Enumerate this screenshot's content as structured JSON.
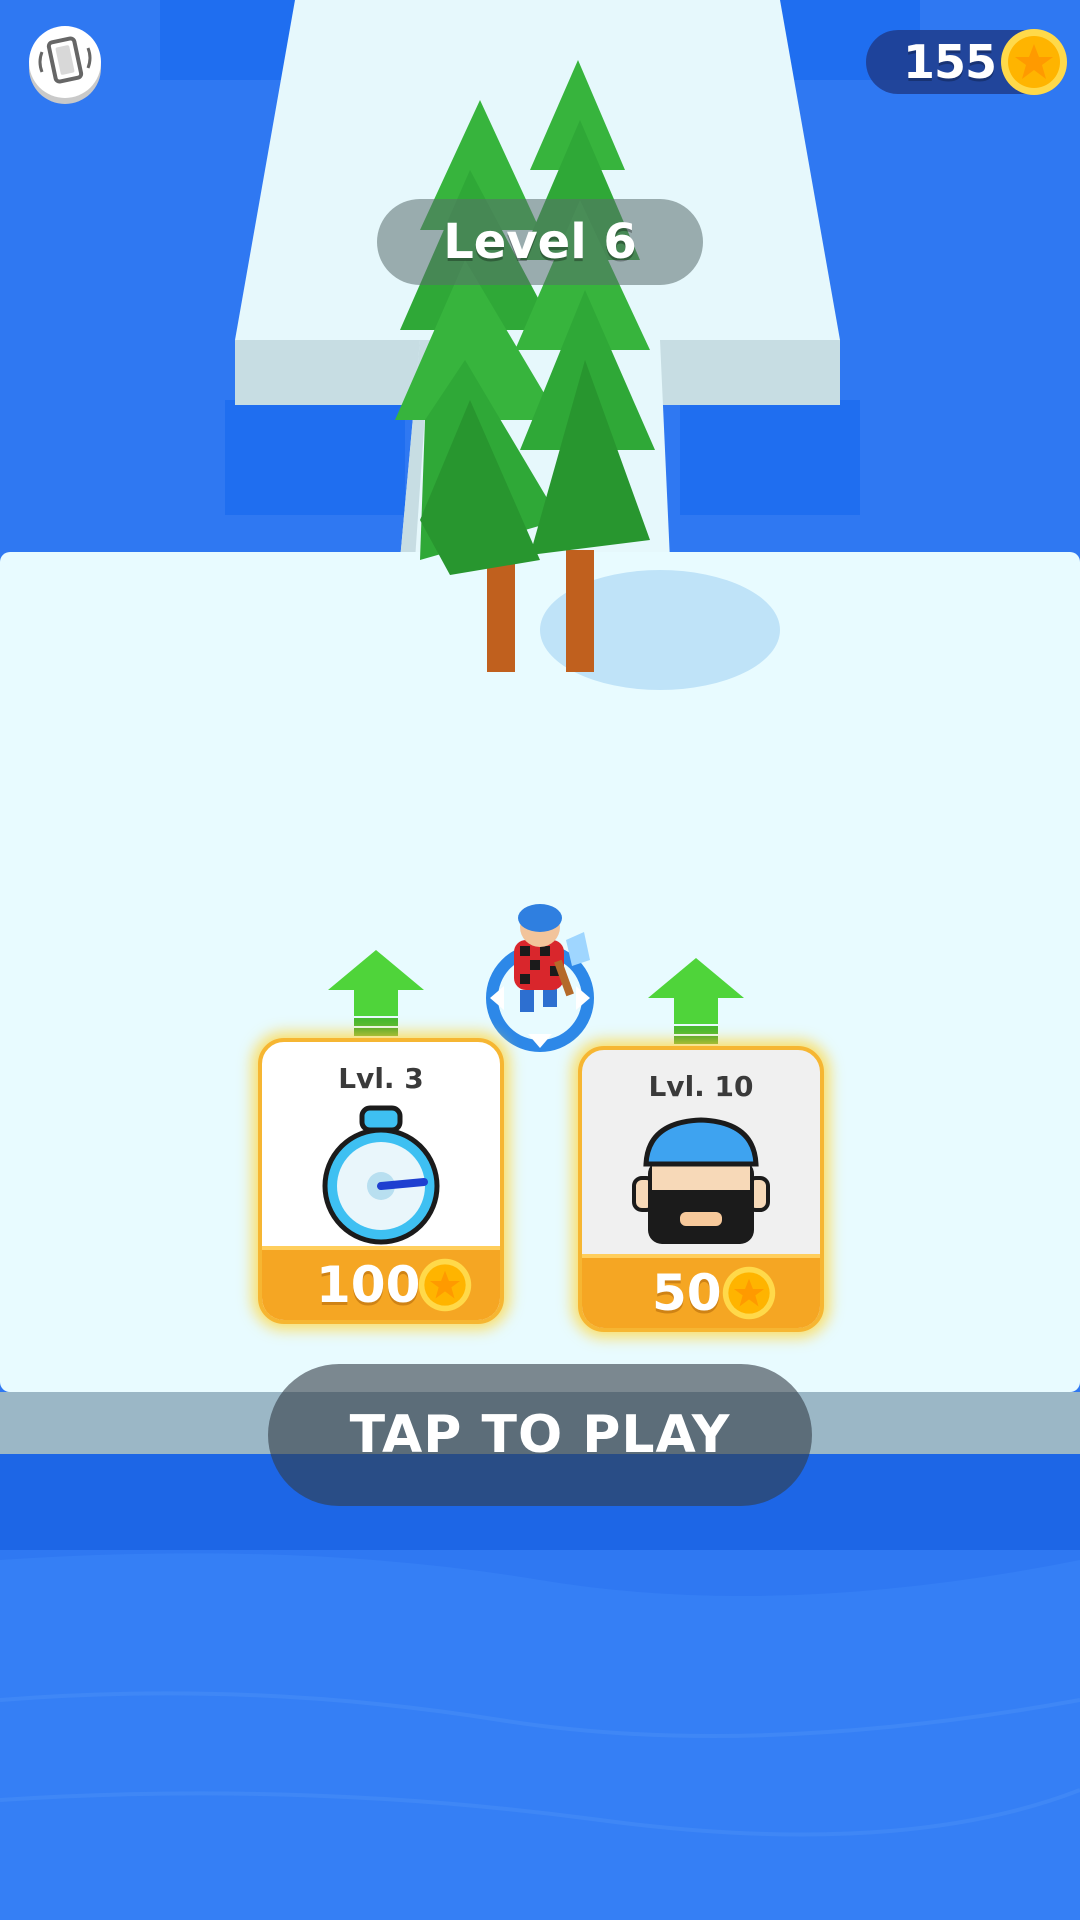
{
  "hud": {
    "coins": "155",
    "vibration_icon": "vibration-icon",
    "coin_icon": "star-coin-icon"
  },
  "level": {
    "label": "Level 6"
  },
  "upgrades": [
    {
      "level": "Lvl. 3",
      "price": "100",
      "icon": "stopwatch-icon"
    },
    {
      "level": "Lvl. 10",
      "price": "50",
      "icon": "lumberjack-icon"
    }
  ],
  "play_button": {
    "label": "TAP TO PLAY"
  },
  "colors": {
    "water": "#2f78f2",
    "ice": "#e8fbff",
    "card_border": "#f6b632",
    "price_bar": "#f5a623",
    "coin": "#ffc21a",
    "tree": "#2fa837"
  }
}
